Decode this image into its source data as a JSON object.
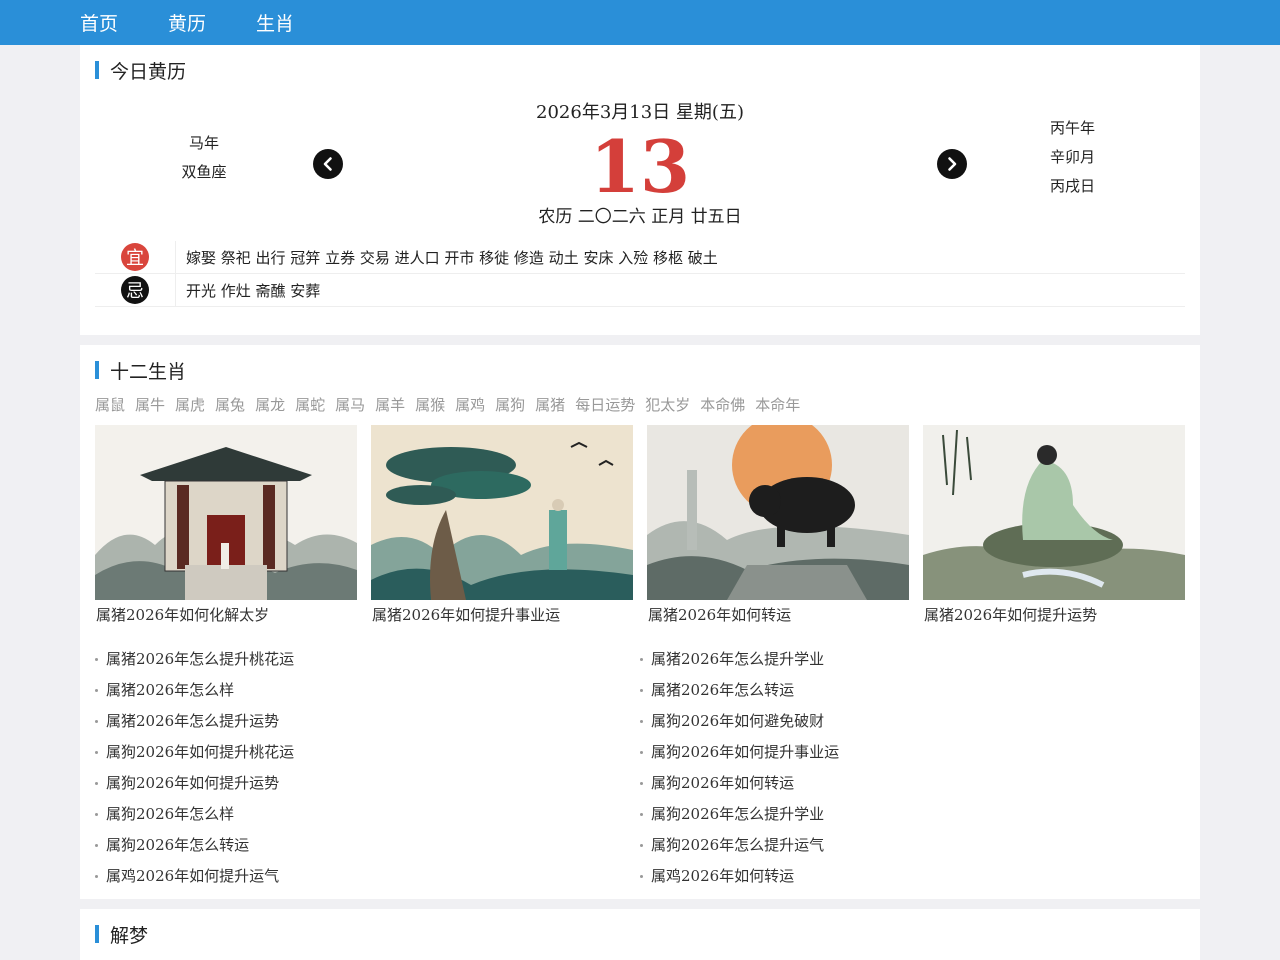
{
  "nav": {
    "items": [
      "首页",
      "黄历",
      "生肖"
    ]
  },
  "almanac": {
    "title": "今日黄历",
    "date_line": "2026年3月13日 星期(五)",
    "day": "13",
    "left": [
      "马年",
      "双鱼座"
    ],
    "right": [
      "丙午年",
      "辛卯月",
      "丙戌日"
    ],
    "lunar": "农历 二〇二六 正月 廿五日",
    "yi_label": "宜",
    "yi_text": "嫁娶 祭祀 出行 冠笄 立券 交易 进人口 开市 移徙 修造 动土 安床 入殓 移柩 破土",
    "ji_label": "忌",
    "ji_text": "开光 作灶 斋醮 安葬"
  },
  "zodiac": {
    "title": "十二生肖",
    "tabs": [
      "属鼠",
      "属牛",
      "属虎",
      "属兔",
      "属龙",
      "属蛇",
      "属马",
      "属羊",
      "属猴",
      "属鸡",
      "属狗",
      "属猪",
      "每日运势",
      "犯太岁",
      "本命佛",
      "本命年"
    ],
    "cards": [
      "属猪2026年如何化解太岁",
      "属猪2026年如何提升事业运",
      "属猪2026年如何转运",
      "属猪2026年如何提升运势"
    ],
    "list_left": [
      "属猪2026年怎么提升桃花运",
      "属猪2026年怎么样",
      "属猪2026年怎么提升运势",
      "属狗2026年如何提升桃花运",
      "属狗2026年如何提升运势",
      "属狗2026年怎么样",
      "属狗2026年怎么转运",
      "属鸡2026年如何提升运气"
    ],
    "list_right": [
      "属猪2026年怎么提升学业",
      "属猪2026年怎么转运",
      "属狗2026年如何避免破财",
      "属狗2026年如何提升事业运",
      "属狗2026年如何转运",
      "属狗2026年怎么提升学业",
      "属狗2026年怎么提升运气",
      "属鸡2026年如何转运"
    ]
  },
  "dream": {
    "title": "解梦"
  },
  "colors": {
    "nav_bg": "#2a8fd8",
    "day_red": "#d43f3a",
    "yi_red": "#d9453c"
  }
}
